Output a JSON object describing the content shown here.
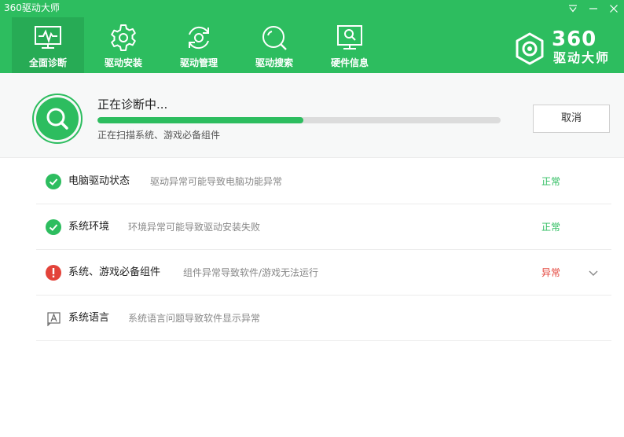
{
  "window": {
    "title": "360驱动大师"
  },
  "nav": {
    "tabs": [
      {
        "label": "全面诊断",
        "icon": "monitor-pulse-icon",
        "active": true
      },
      {
        "label": "驱动安装",
        "icon": "gear-icon",
        "active": false
      },
      {
        "label": "驱动管理",
        "icon": "refresh-gear-icon",
        "active": false
      },
      {
        "label": "驱动搜索",
        "icon": "search-icon",
        "active": false
      },
      {
        "label": "硬件信息",
        "icon": "monitor-search-icon",
        "active": false
      }
    ]
  },
  "brand": {
    "number": "360",
    "name": "驱动大师",
    "icon": "gear-hexagon-logo"
  },
  "scan": {
    "title": "正在诊断中...",
    "status": "正在扫描系统、游戏必备组件",
    "progress_fraction": 0.51,
    "cancel_label": "取消"
  },
  "checks": [
    {
      "title": "电脑驱动状态",
      "desc": "驱动异常可能导致电脑功能异常",
      "status": "正常",
      "state": "ok"
    },
    {
      "title": "系统环境",
      "desc": "环境异常可能导致驱动安装失败",
      "status": "正常",
      "state": "ok"
    },
    {
      "title": "系统、游戏必备组件",
      "desc": "组件异常导致软件/游戏无法运行",
      "status": "异常",
      "state": "error"
    },
    {
      "title": "系统语言",
      "desc": "系统语言问题导致软件显示异常",
      "status": "",
      "state": "pending"
    }
  ],
  "colors": {
    "brand_green": "#2dbd5f",
    "active_tab": "#27ab55",
    "ok_text": "#2dbd5f",
    "error_text": "#e3433a"
  }
}
